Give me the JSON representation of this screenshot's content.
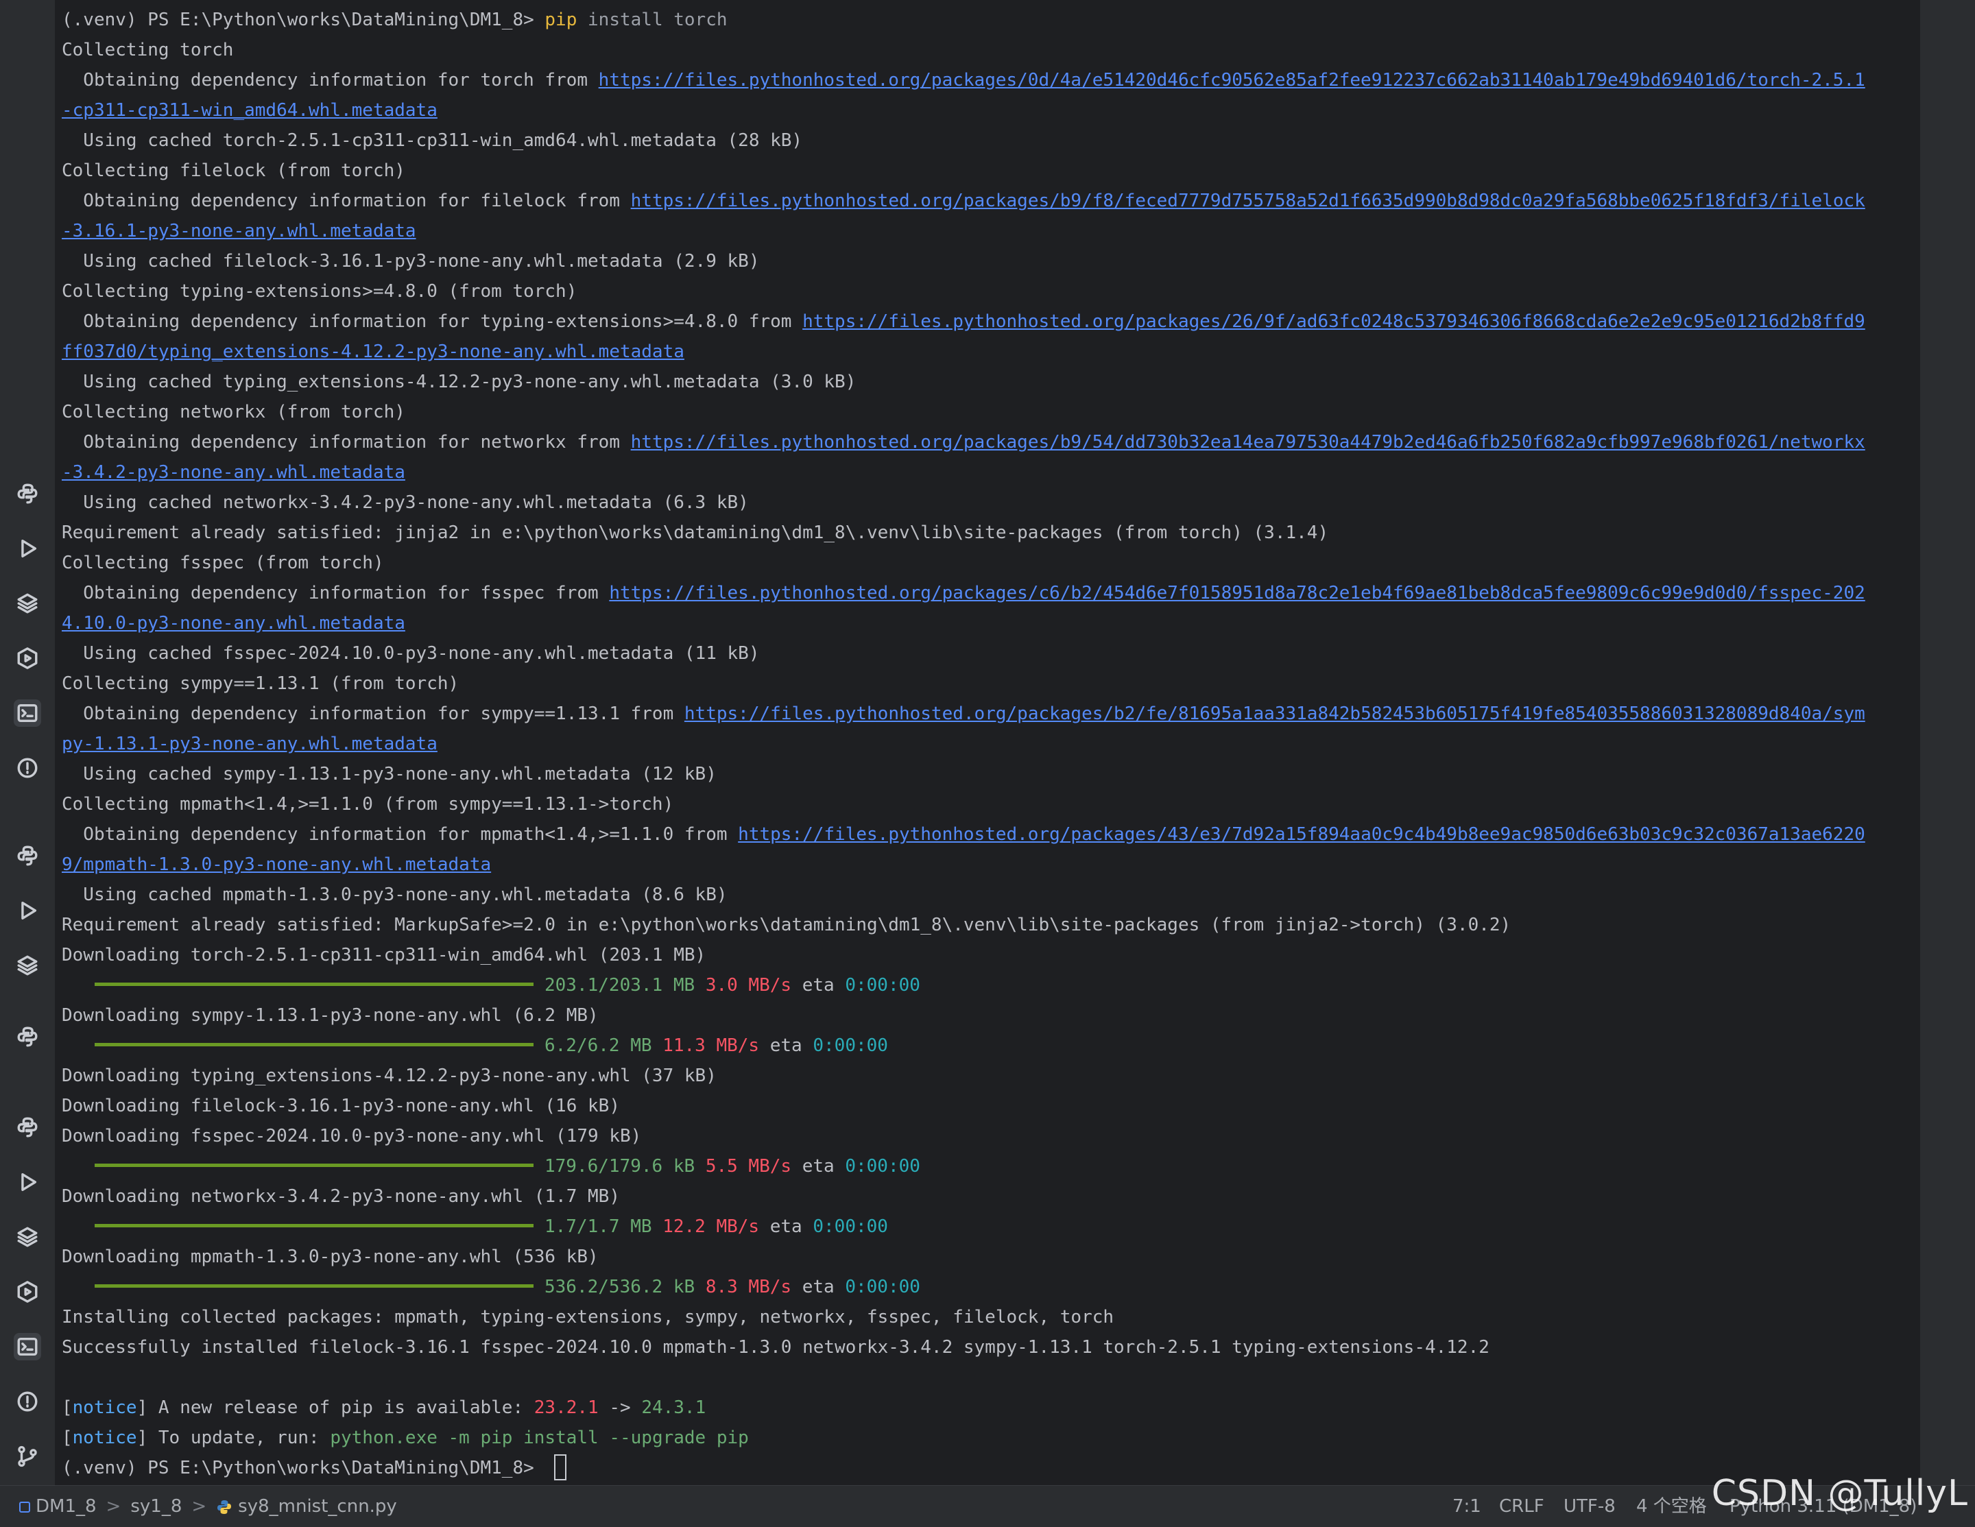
{
  "terminal": {
    "prompt": "(.venv) PS E:\\Python\\works\\DataMining\\DM1_8> ",
    "command": "pip",
    "command_args": " install torch",
    "lines": [
      {
        "t": "Collecting torch"
      },
      {
        "t": "  Obtaining dependency information for torch from ",
        "u": "https://files.pythonhosted.org/packages/0d/4a/e51420d46cfc90562e85af2fee912237c662ab31140ab179e49bd69401d6/torch-2.5.1"
      },
      {
        "t": "",
        "u": "-cp311-cp311-win_amd64.whl.metadata"
      },
      {
        "t": "  Using cached torch-2.5.1-cp311-cp311-win_amd64.whl.metadata (28 kB)"
      },
      {
        "t": "Collecting filelock (from torch)"
      },
      {
        "t": "  Obtaining dependency information for filelock from ",
        "u": "https://files.pythonhosted.org/packages/b9/f8/feced7779d755758a52d1f6635d990b8d98dc0a29fa568bbe0625f18fdf3/filelock"
      },
      {
        "t": "",
        "u": "-3.16.1-py3-none-any.whl.metadata"
      },
      {
        "t": "  Using cached filelock-3.16.1-py3-none-any.whl.metadata (2.9 kB)"
      },
      {
        "t": "Collecting typing-extensions>=4.8.0 (from torch)"
      },
      {
        "t": "  Obtaining dependency information for typing-extensions>=4.8.0 from ",
        "u": "https://files.pythonhosted.org/packages/26/9f/ad63fc0248c5379346306f8668cda6e2e2e9c95e01216d2b8ffd9"
      },
      {
        "t": "",
        "u": "ff037d0/typing_extensions-4.12.2-py3-none-any.whl.metadata"
      },
      {
        "t": "  Using cached typing_extensions-4.12.2-py3-none-any.whl.metadata (3.0 kB)"
      },
      {
        "t": "Collecting networkx (from torch)"
      },
      {
        "t": "  Obtaining dependency information for networkx from ",
        "u": "https://files.pythonhosted.org/packages/b9/54/dd730b32ea14ea797530a4479b2ed46a6fb250f682a9cfb997e968bf0261/networkx"
      },
      {
        "t": "",
        "u": "-3.4.2-py3-none-any.whl.metadata"
      },
      {
        "t": "  Using cached networkx-3.4.2-py3-none-any.whl.metadata (6.3 kB)"
      },
      {
        "t": "Requirement already satisfied: jinja2 in e:\\python\\works\\datamining\\dm1_8\\.venv\\lib\\site-packages (from torch) (3.1.4)"
      },
      {
        "t": "Collecting fsspec (from torch)"
      },
      {
        "t": "  Obtaining dependency information for fsspec from ",
        "u": "https://files.pythonhosted.org/packages/c6/b2/454d6e7f0158951d8a78c2e1eb4f69ae81beb8dca5fee9809c6c99e9d0d0/fsspec-202"
      },
      {
        "t": "",
        "u": "4.10.0-py3-none-any.whl.metadata"
      },
      {
        "t": "  Using cached fsspec-2024.10.0-py3-none-any.whl.metadata (11 kB)"
      },
      {
        "t": "Collecting sympy==1.13.1 (from torch)"
      },
      {
        "t": "  Obtaining dependency information for sympy==1.13.1 from ",
        "u": "https://files.pythonhosted.org/packages/b2/fe/81695a1aa331a842b582453b605175f419fe8540355886031328089d840a/sym"
      },
      {
        "t": "",
        "u": "py-1.13.1-py3-none-any.whl.metadata"
      },
      {
        "t": "  Using cached sympy-1.13.1-py3-none-any.whl.metadata (12 kB)"
      },
      {
        "t": "Collecting mpmath<1.4,>=1.1.0 (from sympy==1.13.1->torch)"
      },
      {
        "t": "  Obtaining dependency information for mpmath<1.4,>=1.1.0 from ",
        "u": "https://files.pythonhosted.org/packages/43/e3/7d92a15f894aa0c9c4b49b8ee9ac9850d6e63b03c9c32c0367a13ae6220"
      },
      {
        "t": "",
        "u": "9/mpmath-1.3.0-py3-none-any.whl.metadata"
      },
      {
        "t": "  Using cached mpmath-1.3.0-py3-none-any.whl.metadata (8.6 kB)"
      },
      {
        "t": "Requirement already satisfied: MarkupSafe>=2.0 in e:\\python\\works\\datamining\\dm1_8\\.venv\\lib\\site-packages (from jinja2->torch) (3.0.2)"
      },
      {
        "t": "Downloading torch-2.5.1-cp311-cp311-win_amd64.whl (203.1 MB)"
      },
      {
        "bar": true,
        "size": "203.1/203.1 MB",
        "speed": "3.0 MB/s",
        "eta_label": "eta",
        "eta": "0:00:00"
      },
      {
        "t": "Downloading sympy-1.13.1-py3-none-any.whl (6.2 MB)"
      },
      {
        "bar": true,
        "size": "6.2/6.2 MB",
        "speed": "11.3 MB/s",
        "eta_label": "eta",
        "eta": "0:00:00"
      },
      {
        "t": "Downloading typing_extensions-4.12.2-py3-none-any.whl (37 kB)"
      },
      {
        "t": "Downloading filelock-3.16.1-py3-none-any.whl (16 kB)"
      },
      {
        "t": "Downloading fsspec-2024.10.0-py3-none-any.whl (179 kB)"
      },
      {
        "bar": true,
        "size": "179.6/179.6 kB",
        "speed": "5.5 MB/s",
        "eta_label": "eta",
        "eta": "0:00:00"
      },
      {
        "t": "Downloading networkx-3.4.2-py3-none-any.whl (1.7 MB)"
      },
      {
        "bar": true,
        "size": "1.7/1.7 MB",
        "speed": "12.2 MB/s",
        "eta_label": "eta",
        "eta": "0:00:00"
      },
      {
        "t": "Downloading mpmath-1.3.0-py3-none-any.whl (536 kB)"
      },
      {
        "bar": true,
        "size": "536.2/536.2 kB",
        "speed": "8.3 MB/s",
        "eta_label": "eta",
        "eta": "0:00:00"
      },
      {
        "t": "Installing collected packages: mpmath, typing-extensions, sympy, networkx, fsspec, filelock, torch"
      },
      {
        "t": "Successfully installed filelock-3.16.1 fsspec-2024.10.0 mpmath-1.3.0 networkx-3.4.2 sympy-1.13.1 torch-2.5.1 typing-extensions-4.12.2"
      },
      {
        "t": ""
      }
    ],
    "notice1": {
      "open": "[",
      "word": "notice",
      "close": "] A new release of pip is available: ",
      "old": "23.2.1",
      "arrow": " -> ",
      "new": "24.3.1"
    },
    "notice2": {
      "open": "[",
      "word": "notice",
      "close": "] To update, run: ",
      "cmd": "python.exe -m pip install --upgrade pip"
    }
  },
  "statusbar": {
    "project": "DM1_8",
    "folder": "sy1_8",
    "file": "sy8_mnist_cnn.py",
    "chevron": ">",
    "position": "7:1",
    "line_sep": "CRLF",
    "encoding": "UTF-8",
    "indent": "4 个空格",
    "interpreter": "Python 3.11 (DM1_8)"
  },
  "watermark": "CSDN @TullyL",
  "colors": {
    "background": "#1e1f22",
    "link": "#548af7",
    "progress": "#6a9a24",
    "size": "#6aab73",
    "speed": "#f75464",
    "eta": "#2aacb8"
  },
  "sidebar_icons": [
    "python-icon",
    "run-icon",
    "layers-icon",
    "services-icon",
    "terminal-icon",
    "problems-icon",
    "python-icon",
    "run-icon",
    "layers-icon",
    "python-icon",
    "python-icon",
    "run-icon",
    "layers-icon",
    "services-icon",
    "terminal-icon",
    "problems-icon",
    "git-icon"
  ]
}
